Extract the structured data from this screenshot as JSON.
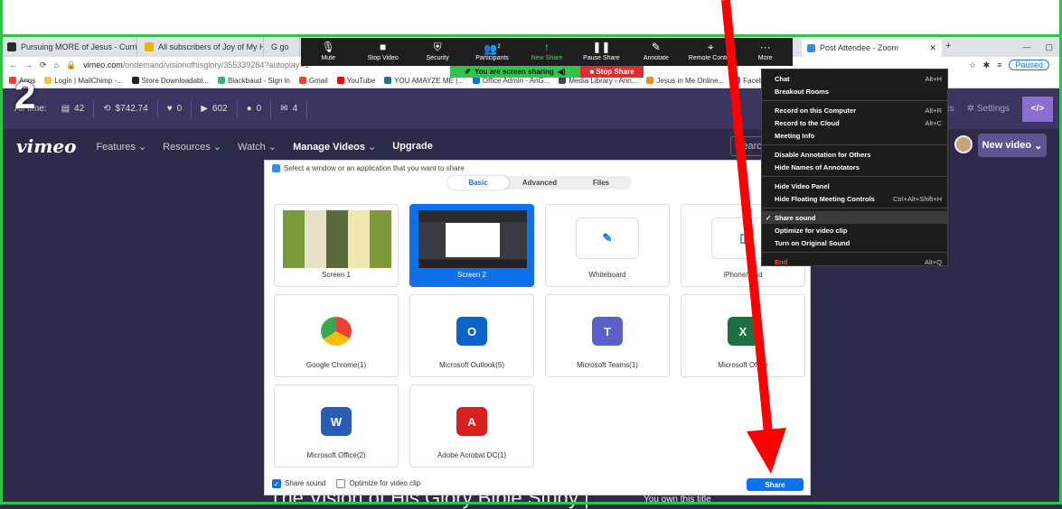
{
  "annotation_number": "2",
  "browser": {
    "tabs": [
      {
        "label": "Pursuing MORE of Jesus - Curric",
        "fav": "#2b2b2b"
      },
      {
        "label": "All subscribers of Joy of My Hea",
        "fav": "#e6b800"
      },
      {
        "label": "G go",
        "fav": "#4285f4"
      }
    ],
    "zoom_tab": "Post Attendee - Zoom",
    "url_host": "vimeo.com",
    "url_path": "/ondemand/visionofhisglory/355339284?autoplay=1",
    "paused_label": "Paused",
    "bookmarks": [
      {
        "label": "Apps",
        "color": "#ea4335"
      },
      {
        "label": "Login | MailChimp -...",
        "color": "#f5c242"
      },
      {
        "label": "Store Downloadabl...",
        "color": "#222"
      },
      {
        "label": "Blackbaud - Sign in",
        "color": "#3bb371"
      },
      {
        "label": "Gmail",
        "color": "#ea4335"
      },
      {
        "label": "YouTube",
        "color": "#ff0000"
      },
      {
        "label": "YOU AMAYZE ME |...",
        "color": "#21759b"
      },
      {
        "label": "Office Admin - AnG...",
        "color": "#0078d4"
      },
      {
        "label": "Media Library ‹ Ann...",
        "color": "#444"
      },
      {
        "label": "Jesus in Me Online...",
        "color": "#f28c28"
      },
      {
        "label": "Facebook",
        "color": "#1877f2"
      }
    ]
  },
  "vimeo": {
    "stats": [
      {
        "icon": "▤",
        "value": "42"
      },
      {
        "icon": "⟲",
        "value": "$742.74"
      },
      {
        "icon": "♥",
        "value": "0"
      },
      {
        "icon": "▶",
        "value": "602"
      },
      {
        "icon": "●",
        "value": "0"
      },
      {
        "icon": "✉",
        "value": "4"
      }
    ],
    "all_time_label": "All time:",
    "analytics_label": "lytics",
    "settings_label": "Settings",
    "logo": "vimeo",
    "nav": [
      "Features",
      "Resources",
      "Watch"
    ],
    "manage_videos": "Manage Videos",
    "upgrade": "Upgrade",
    "search_placeholder": "Search",
    "new_video": "New video",
    "page_title": "The Vision of His Glory Bible Study |",
    "own_title": "You own this title"
  },
  "zoom_toolbar": {
    "buttons": [
      {
        "label": "Mute",
        "icon": "🎙"
      },
      {
        "label": "Stop Video",
        "icon": "■"
      },
      {
        "label": "Security",
        "icon": "⛨"
      },
      {
        "label": "Participants",
        "icon": "👥"
      },
      {
        "label": "New Share",
        "icon": "↑"
      },
      {
        "label": "Pause Share",
        "icon": "❚❚"
      },
      {
        "label": "Annotate",
        "icon": "✎"
      },
      {
        "label": "Remote Control",
        "icon": "⌖"
      },
      {
        "label": "More",
        "icon": "···"
      }
    ],
    "participants_count": "2",
    "sharing_text": "You are screen sharing",
    "stop_share": "Stop Share"
  },
  "share_dialog": {
    "title": "Select a window or an application that you want to share",
    "tabs": [
      "Basic",
      "Advanced",
      "Files"
    ],
    "cards": [
      {
        "label": "Screen 1",
        "kind": "screen"
      },
      {
        "label": "Screen 2",
        "kind": "screen",
        "selected": true
      },
      {
        "label": "Whiteboard",
        "kind": "whiteboard"
      },
      {
        "label": "iPhone/iPad",
        "kind": "iphone"
      },
      {
        "label": "Google Chrome(1)",
        "kind": "chrome"
      },
      {
        "label": "Microsoft Outlook(5)",
        "kind": "outlook"
      },
      {
        "label": "Microsoft Teams(1)",
        "kind": "teams"
      },
      {
        "label": "Microsoft Office",
        "kind": "excel"
      },
      {
        "label": "Microsoft Office(2)",
        "kind": "word"
      },
      {
        "label": "Adobe Acrobat DC(1)",
        "kind": "acrobat"
      }
    ],
    "share_sound": "Share sound",
    "optimize": "Optimize for video clip",
    "share_button": "Share"
  },
  "more_menu": {
    "items": [
      {
        "label": "Chat",
        "shortcut": "Alt+H"
      },
      {
        "label": "Breakout Rooms",
        "shortcut": ""
      },
      {
        "sep": true
      },
      {
        "label": "Record on this Computer",
        "shortcut": "Alt+R"
      },
      {
        "label": "Record to the Cloud",
        "shortcut": "Alt+C"
      },
      {
        "label": "Meeting Info",
        "shortcut": ""
      },
      {
        "sep": true
      },
      {
        "label": "Disable Annotation for Others",
        "shortcut": ""
      },
      {
        "label": "Hide Names of Annotators",
        "shortcut": ""
      },
      {
        "sep": true
      },
      {
        "label": "Hide Video Panel",
        "shortcut": ""
      },
      {
        "label": "Hide Floating Meeting Controls",
        "shortcut": "Ctrl+Alt+Shift+H"
      },
      {
        "sep": true
      },
      {
        "label": "Share sound",
        "shortcut": "",
        "checked": true
      },
      {
        "label": "Optimize for video clip",
        "shortcut": ""
      },
      {
        "label": "Turn on Original Sound",
        "shortcut": ""
      },
      {
        "sep": true
      },
      {
        "label": "End",
        "shortcut": "Alt+Q",
        "danger": true
      }
    ]
  },
  "colors": {
    "zoom_blue": "#0e71eb",
    "share_green": "#30c54a",
    "arrow_red": "#ff0000"
  }
}
